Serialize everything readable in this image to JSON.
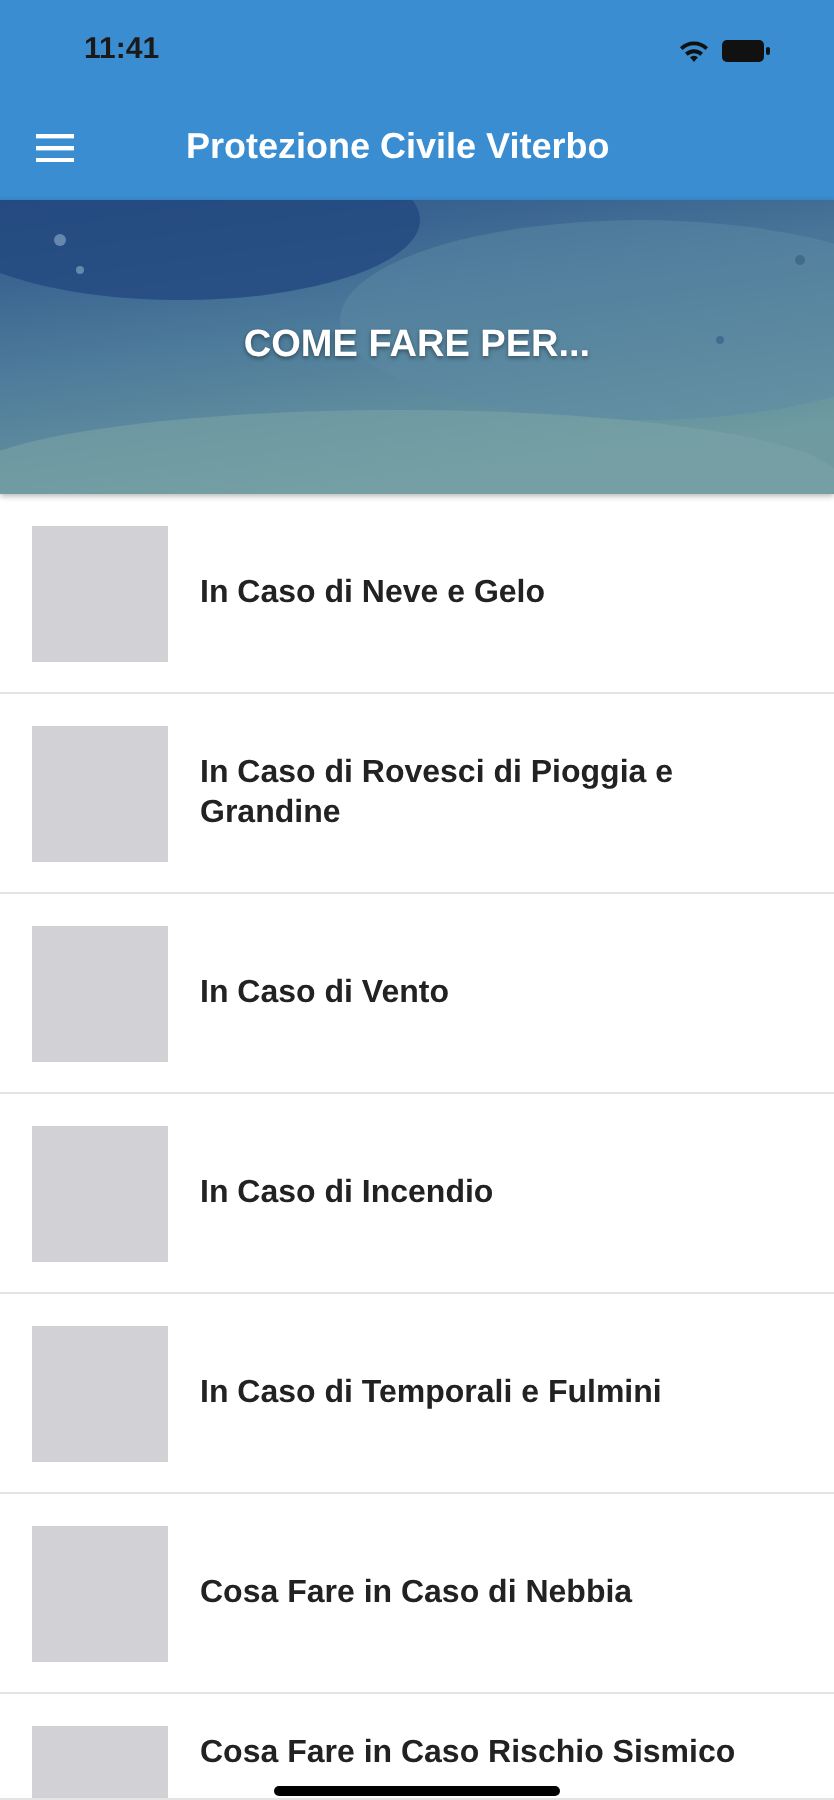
{
  "status_bar": {
    "time": "11:41"
  },
  "app_bar": {
    "title": "Protezione Civile Viterbo"
  },
  "banner": {
    "kind": "picture",
    "title": "COME FARE PER..."
  },
  "items": [
    {
      "label": "In Caso di Neve e Gelo"
    },
    {
      "label": "In Caso di Rovesci di Pioggia e Grandine"
    },
    {
      "label": "In Caso di Vento"
    },
    {
      "label": "In Caso di Incendio"
    },
    {
      "label": "In Caso di Temporali e Fulmini"
    },
    {
      "label": "Cosa Fare in Caso di Nebbia"
    },
    {
      "label": "Cosa Fare in Caso Rischio Sismico"
    }
  ]
}
